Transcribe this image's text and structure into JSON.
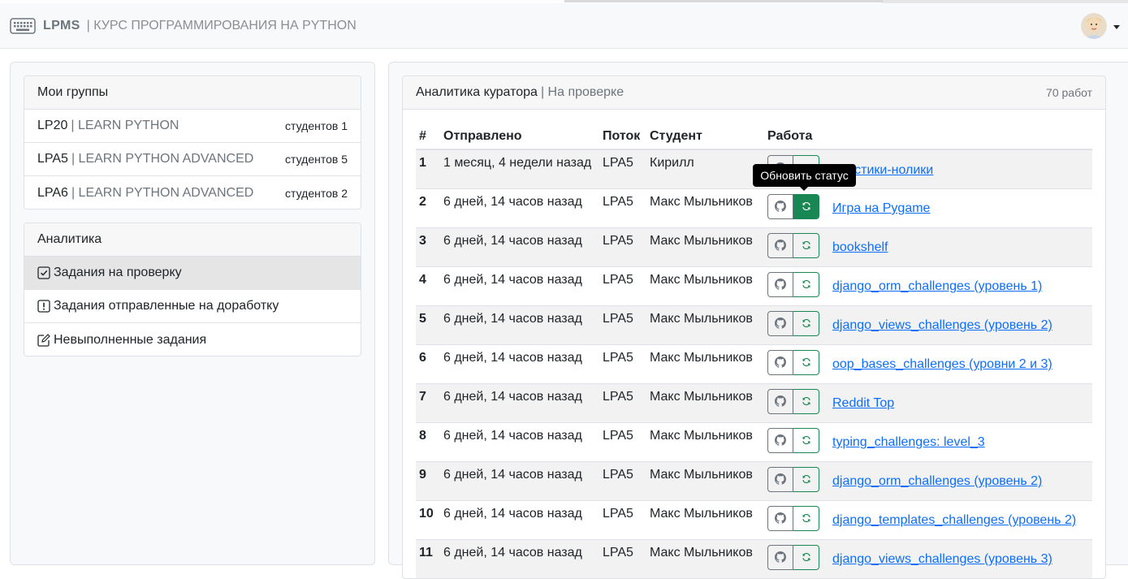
{
  "navbar": {
    "brand": "LPMS",
    "subtitle": "| КУРС ПРОГРАММИРОВАНИЯ НА PYTHON",
    "brand_icon": "keyboard-icon",
    "avatar_icon": "user-avatar"
  },
  "groups": {
    "title": "Мои группы",
    "items": [
      {
        "code": "LP20",
        "name": "| LEARN PYTHON",
        "count": "студентов 1"
      },
      {
        "code": "LPA5",
        "name": "| LEARN PYTHON ADVANCED",
        "count": "студентов 5"
      },
      {
        "code": "LPA6",
        "name": "| LEARN PYTHON ADVANCED",
        "count": "студентов 2"
      }
    ]
  },
  "analytics": {
    "title": "Аналитика",
    "items": [
      {
        "label": "Задания на проверку",
        "icon": "check-square-icon"
      },
      {
        "label": "Задания отправленные на доработку",
        "icon": "exclamation-square-icon"
      },
      {
        "label": "Невыполненные задания",
        "icon": "pencil-square-icon"
      }
    ]
  },
  "curator": {
    "title": "Аналитика куратора",
    "subtitle": "| На проверке",
    "count": "70 работ",
    "columns": [
      "#",
      "Отправлено",
      "Поток",
      "Студент",
      "Работа"
    ],
    "tooltip": "Обновить статус",
    "rows": [
      {
        "num": "1",
        "sent": "1 месяц, 4 недели назад",
        "stream": "LPA5",
        "student": "Кирилл",
        "work": "Крестики-нолики"
      },
      {
        "num": "2",
        "sent": "6 дней, 14 часов назад",
        "stream": "LPA5",
        "student": "Макс Мыльников",
        "work": "Игра на Pygame"
      },
      {
        "num": "3",
        "sent": "6 дней, 14 часов назад",
        "stream": "LPA5",
        "student": "Макс Мыльников",
        "work": "bookshelf"
      },
      {
        "num": "4",
        "sent": "6 дней, 14 часов назад",
        "stream": "LPA5",
        "student": "Макс Мыльников",
        "work": "django_orm_challenges (уровень 1)"
      },
      {
        "num": "5",
        "sent": "6 дней, 14 часов назад",
        "stream": "LPA5",
        "student": "Макс Мыльников",
        "work": "django_views_challenges (уровень 2)"
      },
      {
        "num": "6",
        "sent": "6 дней, 14 часов назад",
        "stream": "LPA5",
        "student": "Макс Мыльников",
        "work": "oop_bases_challenges (уровни 2 и 3)"
      },
      {
        "num": "7",
        "sent": "6 дней, 14 часов назад",
        "stream": "LPA5",
        "student": "Макс Мыльников",
        "work": "Reddit Top"
      },
      {
        "num": "8",
        "sent": "6 дней, 14 часов назад",
        "stream": "LPA5",
        "student": "Макс Мыльников",
        "work": "typing_challenges: level_3"
      },
      {
        "num": "9",
        "sent": "6 дней, 14 часов назад",
        "stream": "LPA5",
        "student": "Макс Мыльников",
        "work": "django_orm_challenges (уровень 2)"
      },
      {
        "num": "10",
        "sent": "6 дней, 14 часов назад",
        "stream": "LPA5",
        "student": "Макс Мыльников",
        "work": "django_templates_challenges (уровень 2)"
      },
      {
        "num": "11",
        "sent": "6 дней, 14 часов назад",
        "stream": "LPA5",
        "student": "Макс Мыльников",
        "work": "django_views_challenges (уровень 3)"
      }
    ]
  },
  "colors": {
    "accent": "#198754",
    "link": "#0d6efd"
  }
}
